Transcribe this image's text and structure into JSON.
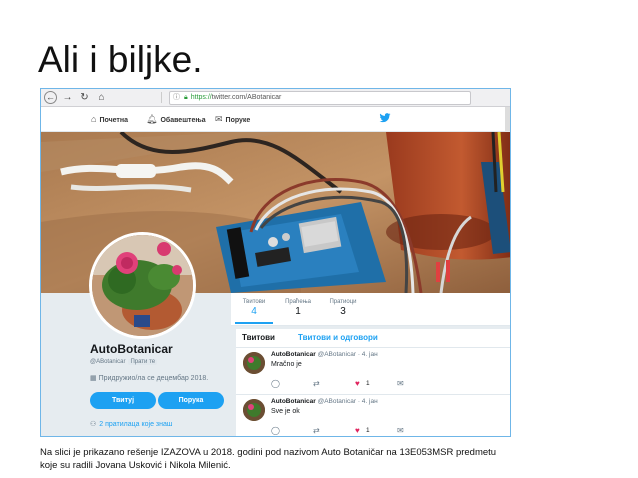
{
  "slide": {
    "title": "Ali i biljke.",
    "caption_line1": "Na slici je prikazano rešenje IZAZOVA u 2018. godini pod nazivom Auto Botaničar na 13E053MSR predmetu",
    "caption_line2": "koje su radili Jovana Usković i Nikola Milenić."
  },
  "browser": {
    "url_https": "https://",
    "url_rest": "twitter.com/ABotanicar"
  },
  "twitter_nav": {
    "home": "Почетна",
    "notifications": "Обавештења",
    "messages": "Поруке"
  },
  "stats": [
    {
      "label": "Твитови",
      "value": "4"
    },
    {
      "label": "Праћења",
      "value": "1"
    },
    {
      "label": "Пратиоци",
      "value": "3"
    }
  ],
  "profile": {
    "name": "AutoBotanicar",
    "handle": "@ABotanicar",
    "follows_you": "Прати те",
    "joined": "Придружио/ла се децембар 2018.",
    "tweet_button": "Твитуј",
    "message_button": "Порука",
    "followers_you_know": "2 пратилаца које знаш"
  },
  "feed": {
    "tab_tweets": "Твитови",
    "tab_replies": "Твитови и одговори",
    "tweets": [
      {
        "name": "AutoBotanicar",
        "handle": "@ABotanicar",
        "date": "· 4. јан",
        "text": "Mračno je",
        "likes": "1"
      },
      {
        "name": "AutoBotanicar",
        "handle": "@ABotanicar",
        "date": "· 4. јан",
        "text": "Sve je ok",
        "likes": "1"
      }
    ]
  },
  "colors": {
    "accent": "#1da1f2",
    "like": "#e0245e"
  }
}
